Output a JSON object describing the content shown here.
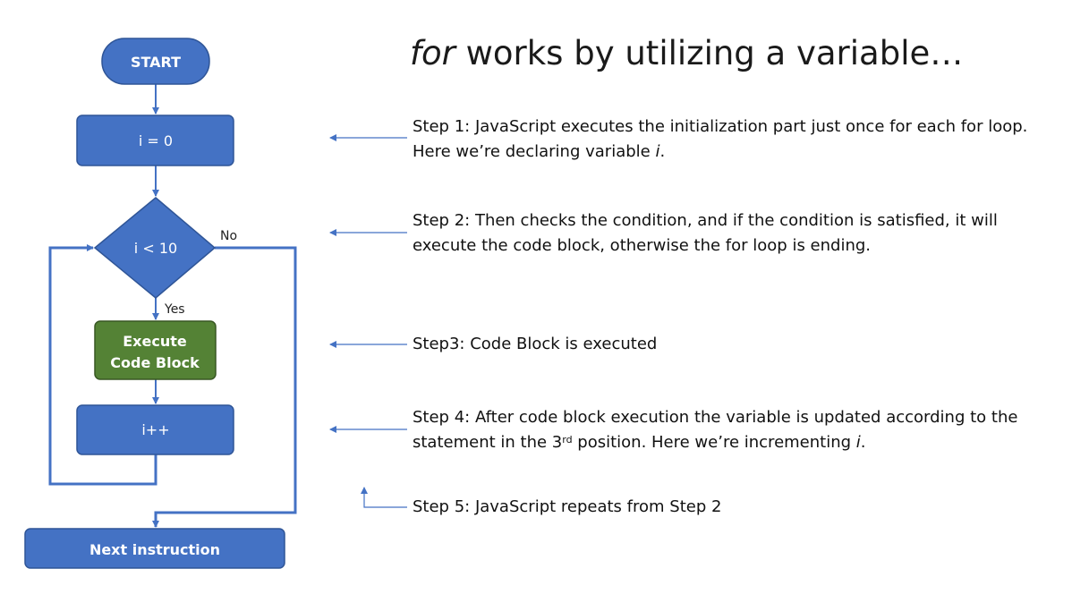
{
  "title": {
    "italic": "for",
    "rest": " works by utilizing a variable…"
  },
  "colors": {
    "process": "#4472c4",
    "process_border": "#2f5597",
    "execute": "#548235",
    "execute_border": "#385723",
    "line": "#4472c4"
  },
  "flowchart": {
    "start": "START",
    "init": "i = 0",
    "condition": "i < 10",
    "no_label": "No",
    "yes_label": "Yes",
    "execute_line1": "Execute",
    "execute_line2": "Code Block",
    "update": "i++",
    "next": "Next instruction"
  },
  "steps": {
    "step1": {
      "line1": "Step 1: JavaScript executes the initialization part just once for each for loop.",
      "line2_prefix": "Here we’re declaring variable ",
      "line2_var": "i",
      "line2_suffix": "."
    },
    "step2": {
      "line1": "Step 2: Then checks the condition, and if the condition is satisfied, it will",
      "line2": "execute the code block, otherwise the for loop is ending."
    },
    "step3": {
      "line1": "Step3: Code Block is executed"
    },
    "step4": {
      "line1": "Step 4: After code block execution the variable is updated according to the",
      "line2_prefix": "statement in the 3",
      "line2_sup": "rd",
      "line2_mid": " position. Here we’re incrementing ",
      "line2_var": "i",
      "line2_suffix": "."
    },
    "step5": {
      "line1": "Step 5: JavaScript repeats from Step 2"
    }
  }
}
